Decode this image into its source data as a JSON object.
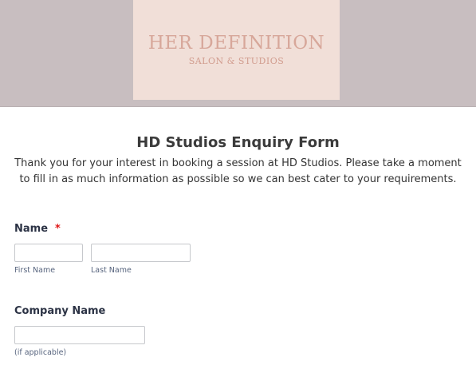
{
  "header": {
    "logo_title": "HER DEFINITION",
    "logo_subtitle": "SALON & STUDIOS"
  },
  "form": {
    "title": "HD Studios Enquiry Form",
    "description": "Thank you for your interest in booking a session at HD Studios. Please take a moment to fill in as much information as possible so we can best cater to your requirements.",
    "fields": {
      "name": {
        "label": "Name",
        "required_mark": "*",
        "first_name": {
          "value": "",
          "sublabel": "First Name"
        },
        "last_name": {
          "value": "",
          "sublabel": "Last Name"
        }
      },
      "company": {
        "label": "Company Name",
        "value": "",
        "sublabel": "(if applicable)"
      }
    }
  },
  "colors": {
    "header_band": "#c8bec0",
    "logo_card": "#f1dfd8",
    "logo_text": "#d7a79a",
    "required": "#e01818"
  }
}
